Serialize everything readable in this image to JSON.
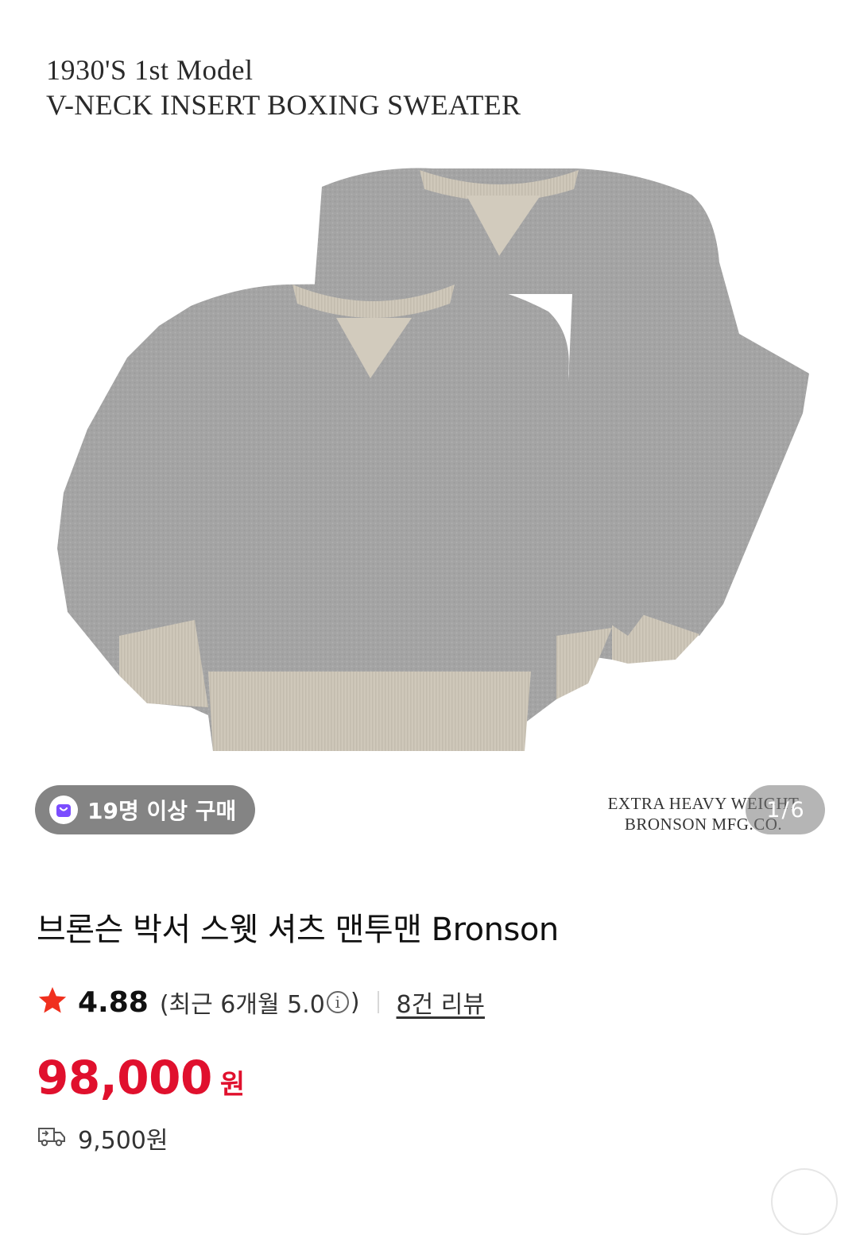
{
  "gallery": {
    "caption_line1": "1930'S 1st Model",
    "caption_line2": "V-NECK INSERT BOXING SWEATER",
    "stamp_line1": "EXTRA HEAVY WEIGHT",
    "stamp_line2": "BRONSON MFG.CO.",
    "badge_label": "19명 이상 구매",
    "counter_current": "1",
    "counter_total": "6",
    "counter_separator": "/"
  },
  "product": {
    "title": "브론슨 박서 스웻 셔츠 맨투맨 Bronson",
    "rating": "4.88",
    "recent_prefix": "(최근 6개월 5.0",
    "recent_suffix": ")",
    "info_glyph": "i",
    "review_link": "8건 리뷰",
    "price": "98,000",
    "currency": "원",
    "shipping_fee": "9,500원"
  },
  "colors": {
    "price": "#e0102d",
    "star": "#f0301e",
    "badge_bg": "#6e6e6e",
    "badge_icon": "#7b4dff",
    "sweater_body": "#a3a3a3",
    "sweater_rib": "#cdc6b8"
  },
  "icons": {
    "star": "star-icon",
    "badge": "shopping-bag-icon",
    "info": "info-icon",
    "shipping": "truck-icon"
  }
}
